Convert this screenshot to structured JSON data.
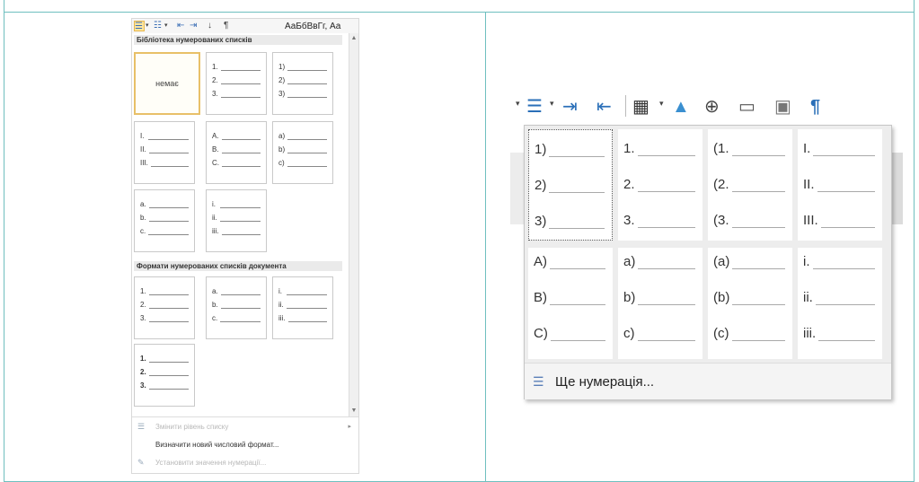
{
  "word": {
    "toolbar": {
      "numbering_icon": "numbered-list-icon",
      "styles_text": "АаБбВвГг,  Аа"
    },
    "library_header": "Бібліотека нумерованих списків",
    "document_header": "Формати нумерованих списків документа",
    "none_label": "немає",
    "library_tiles": [
      {
        "rows": [
          "1.",
          "2.",
          "3."
        ]
      },
      {
        "rows": [
          "1)",
          "2)",
          "3)"
        ]
      },
      {
        "rows": [
          "I.",
          "II.",
          "III."
        ]
      },
      {
        "rows": [
          "A.",
          "B.",
          "C."
        ]
      },
      {
        "rows": [
          "a)",
          "b)",
          "c)"
        ]
      },
      {
        "rows": [
          "a.",
          "b.",
          "c."
        ]
      },
      {
        "rows": [
          "i.",
          "ii.",
          "iii."
        ]
      }
    ],
    "document_tiles": [
      {
        "rows": [
          "1.",
          "2.",
          "3."
        ]
      },
      {
        "rows": [
          "a.",
          "b.",
          "c."
        ]
      },
      {
        "rows": [
          "i.",
          "ii.",
          "iii."
        ]
      },
      {
        "rows": [
          "1.",
          "2.",
          "3."
        ]
      }
    ],
    "menu": {
      "change_level": "Змінити рівень списку",
      "define_format": "Визначити новий числовий формат...",
      "set_value": "Установити значення нумерації..."
    }
  },
  "lo": {
    "tiles": [
      {
        "rows": [
          "1)",
          "2)",
          "3)"
        ]
      },
      {
        "rows": [
          "1.",
          "2.",
          "3."
        ]
      },
      {
        "rows": [
          "(1.",
          "(2.",
          "(3."
        ]
      },
      {
        "rows": [
          "I.",
          "II.",
          "III."
        ]
      },
      {
        "rows": [
          "A)",
          "B)",
          "C)"
        ]
      },
      {
        "rows": [
          "a)",
          "b)",
          "c)"
        ]
      },
      {
        "rows": [
          "(a)",
          "(b)",
          "(c)"
        ]
      },
      {
        "rows": [
          "i.",
          "ii.",
          "iii."
        ]
      }
    ],
    "more_label": "Ще нумерація..."
  }
}
